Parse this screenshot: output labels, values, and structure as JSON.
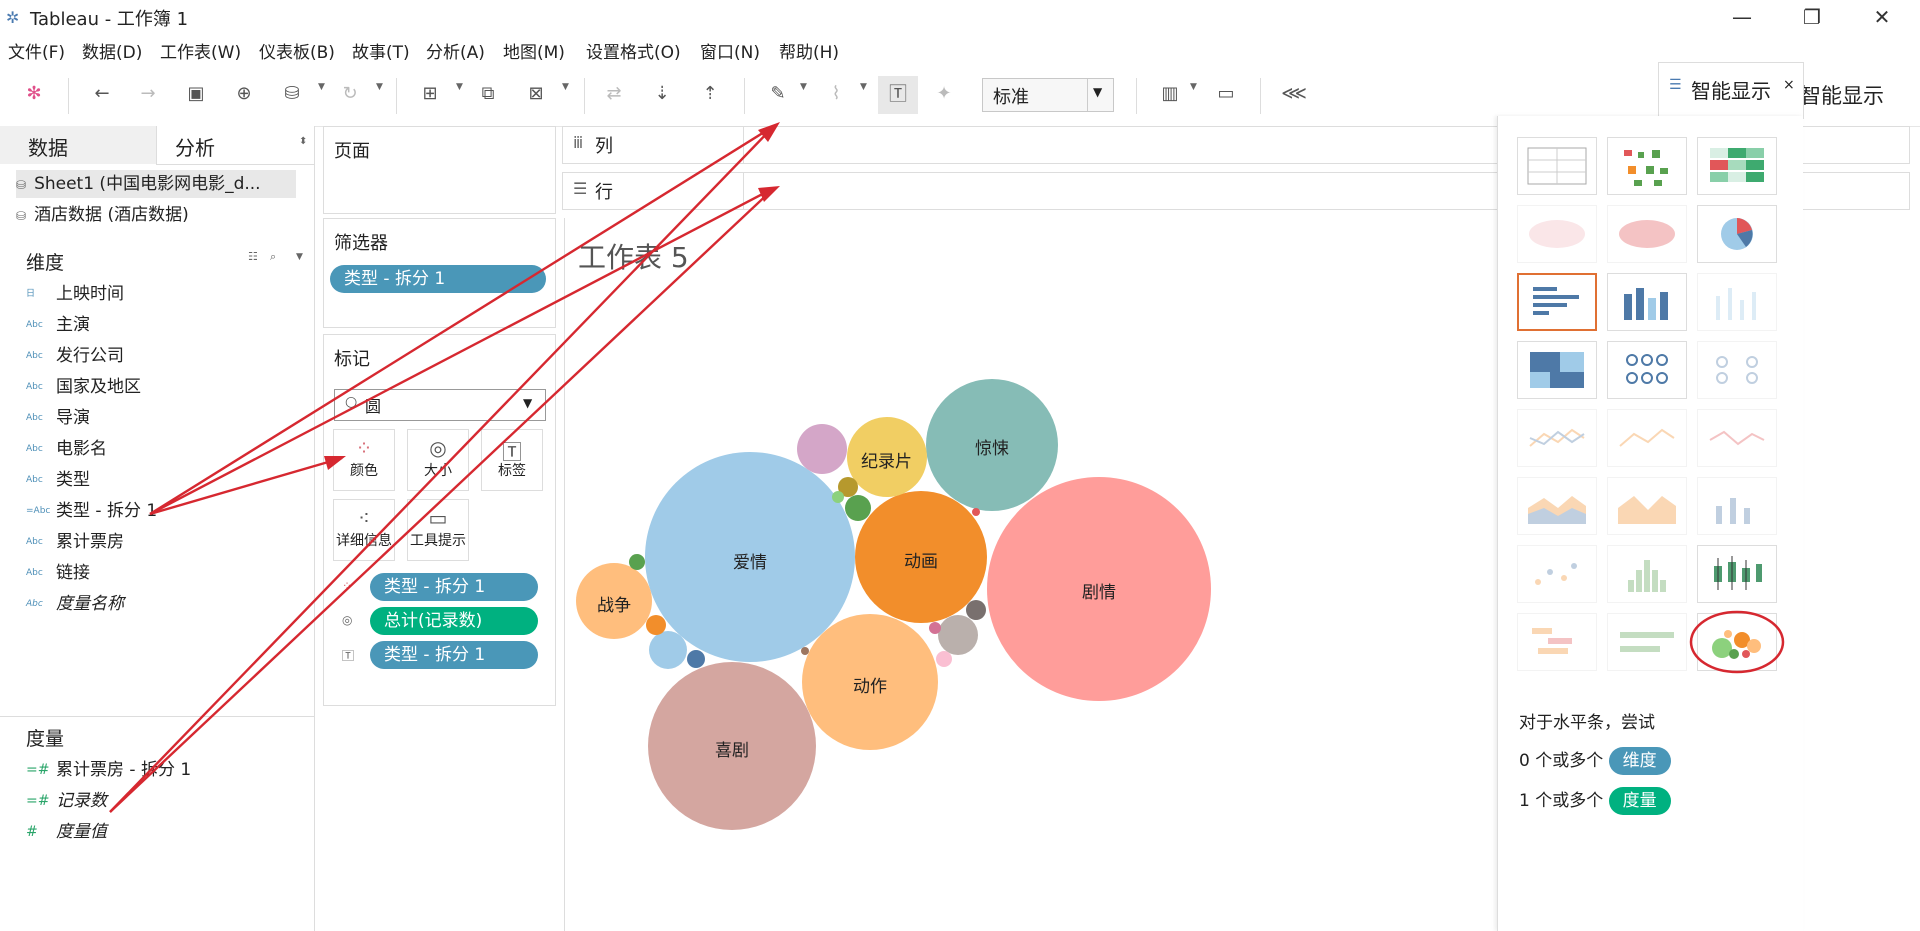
{
  "window": {
    "title": "Tableau - 工作簿 1",
    "min": "—",
    "max": "❐",
    "close": "✕"
  },
  "menu": [
    "文件(F)",
    "数据(D)",
    "工作表(W)",
    "仪表板(B)",
    "故事(T)",
    "分析(A)",
    "地图(M)",
    "设置格式(O)",
    "窗口(N)",
    "帮助(H)"
  ],
  "toolbar": {
    "fit": "标准",
    "showme_label": "智能显示"
  },
  "left": {
    "tab_data": "数据",
    "tab_analysis": "分析",
    "datasources": [
      "Sheet1 (中国电影网电影_d...",
      "酒店数据 (酒店数据)"
    ],
    "dimensions_title": "维度",
    "dimensions": [
      {
        "icon": "日",
        "name": "上映时间"
      },
      {
        "icon": "Abc",
        "name": "主演"
      },
      {
        "icon": "Abc",
        "name": "发行公司"
      },
      {
        "icon": "Abc",
        "name": "国家及地区"
      },
      {
        "icon": "Abc",
        "name": "导演"
      },
      {
        "icon": "Abc",
        "name": "电影名"
      },
      {
        "icon": "Abc",
        "name": "类型"
      },
      {
        "icon": "=Abc",
        "name": "类型 - 拆分 1"
      },
      {
        "icon": "Abc",
        "name": "累计票房"
      },
      {
        "icon": "Abc",
        "name": "链接"
      },
      {
        "icon": "Abc",
        "name": "度量名称"
      }
    ],
    "measures_title": "度量",
    "measures": [
      {
        "icon": "=#",
        "name": "累计票房 - 拆分 1"
      },
      {
        "icon": "=#",
        "name": "记录数"
      },
      {
        "icon": "#",
        "name": "度量值"
      }
    ]
  },
  "shelves": {
    "pages": "页面",
    "filters": "筛选器",
    "filter_pill": "类型 - 拆分 1",
    "marks": "标记",
    "mark_type": "圆",
    "mark_buttons": [
      "颜色",
      "大小",
      "标签",
      "详细信息",
      "工具提示"
    ],
    "mark_pills": [
      "类型 - 拆分 1",
      "总计(记录数)",
      "类型 - 拆分 1"
    ],
    "columns": "列",
    "rows": "行"
  },
  "sheet_title": "工作表 5",
  "bubbles": [
    {
      "label": "剧情",
      "color": "#ff9d9a"
    },
    {
      "label": "爱情",
      "color": "#a0cbe8"
    },
    {
      "label": "喜剧",
      "color": "#d4a6a0"
    },
    {
      "label": "动画",
      "color": "#f28e2b"
    },
    {
      "label": "动作",
      "color": "#ffbe7d"
    },
    {
      "label": "惊悚",
      "color": "#86bcb6"
    },
    {
      "label": "纪录片",
      "color": "#f1ce63"
    },
    {
      "label": "战争",
      "color": "#ffbe7d"
    }
  ],
  "showme": {
    "title": "智能显示",
    "hint": "对于水平条，尝试",
    "req1_prefix": "0 个或多个",
    "req1_tag": "维度",
    "req2_prefix": "1 个或多个",
    "req2_tag": "度量"
  }
}
